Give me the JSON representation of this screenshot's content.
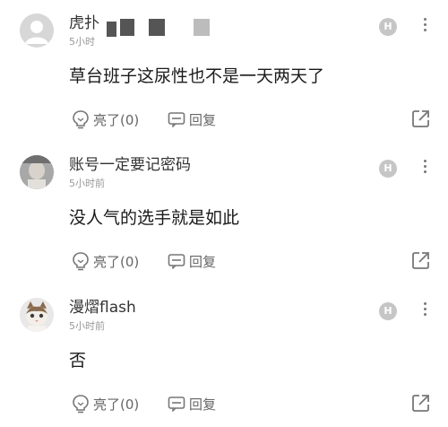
{
  "comments": [
    {
      "username": "虎扑",
      "time": "5小时前",
      "time_visible": "5小时",
      "badge": "H",
      "content": "草台班子这尿性也不是一天两天了",
      "like_label": "亮了(0)",
      "reply_label": "回复"
    },
    {
      "username": "账号一定要记密码",
      "time": "5小时前",
      "badge": "H",
      "content": "没人气的选手就是如此",
      "like_label": "亮了(0)",
      "reply_label": "回复"
    },
    {
      "username": "漫熠flash",
      "time": "5小时前",
      "badge": "H",
      "content": "否",
      "like_label": "亮了(0)",
      "reply_label": "回复"
    }
  ]
}
